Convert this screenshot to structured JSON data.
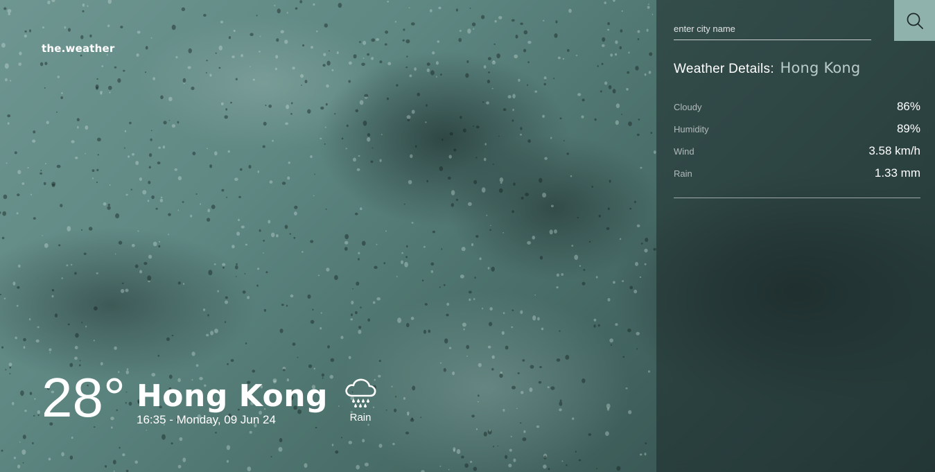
{
  "brand": "the.weather",
  "current": {
    "temperature": "28°",
    "city": "Hong Kong",
    "datetime": "16:35 - Monday, 09 Jun 24",
    "condition": "Rain",
    "condition_icon": "rain-cloud-icon"
  },
  "search": {
    "placeholder": "enter city name",
    "value": "",
    "button_icon": "search-icon"
  },
  "details": {
    "heading": "Weather Details:",
    "city": "Hong Kong",
    "items": [
      {
        "label": "Cloudy",
        "value": "86%"
      },
      {
        "label": "Humidity",
        "value": "89%"
      },
      {
        "label": "Wind",
        "value": "3.58 km/h"
      },
      {
        "label": "Rain",
        "value": "1.33 mm"
      }
    ]
  },
  "colors": {
    "background": "#5f8883",
    "panel": "#1c2a2a",
    "search_button": "#8fb2ad",
    "details_city": "#b9ccc9"
  }
}
